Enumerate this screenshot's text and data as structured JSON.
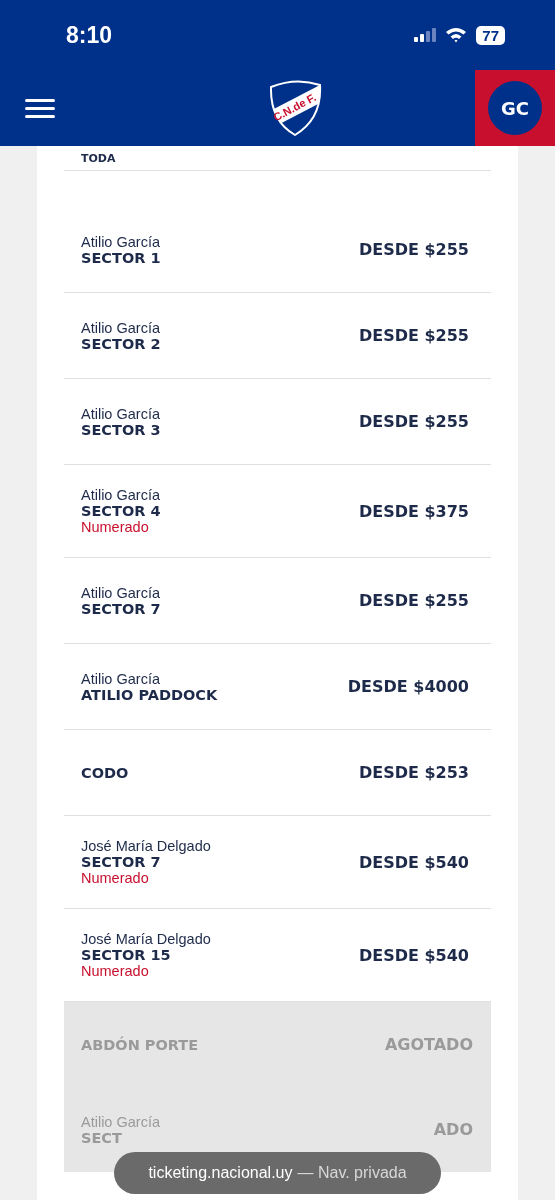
{
  "status_bar": {
    "time": "8:10",
    "battery": "77"
  },
  "header": {
    "logo_text": "C.N.de F.",
    "avatar": "GC"
  },
  "filter_label": "TODA",
  "sectors": [
    {
      "stand": "Atilio García",
      "sector": "SECTOR 1",
      "price": "DESDE $255",
      "sold_out": false
    },
    {
      "stand": "Atilio García",
      "sector": "SECTOR 2",
      "price": "DESDE $255",
      "sold_out": false
    },
    {
      "stand": "Atilio García",
      "sector": "SECTOR 3",
      "price": "DESDE $255",
      "sold_out": false
    },
    {
      "stand": "Atilio García",
      "sector": "SECTOR 4",
      "note": "Numerado",
      "price": "DESDE $375",
      "sold_out": false
    },
    {
      "stand": "Atilio García",
      "sector": "SECTOR 7",
      "price": "DESDE $255",
      "sold_out": false
    },
    {
      "stand": "Atilio García",
      "sector": "ATILIO PADDOCK",
      "price": "DESDE $4000",
      "sold_out": false
    },
    {
      "sector": "CODO",
      "price": "DESDE $253",
      "sold_out": false
    },
    {
      "stand": "José María Delgado",
      "sector": "SECTOR 7",
      "note": "Numerado",
      "price": "DESDE $540",
      "sold_out": false
    },
    {
      "stand": "José María Delgado",
      "sector": "SECTOR 15",
      "note": "Numerado",
      "price": "DESDE $540",
      "sold_out": false
    },
    {
      "sector": "ABDÓN PORTE",
      "price": "AGOTADO",
      "sold_out": true
    },
    {
      "stand": "Atilio García",
      "sector": "SECT",
      "price": "ADO",
      "sold_out": true
    }
  ],
  "toast": {
    "domain": "ticketing.nacional.uy",
    "mode": "— Nav. privada"
  }
}
